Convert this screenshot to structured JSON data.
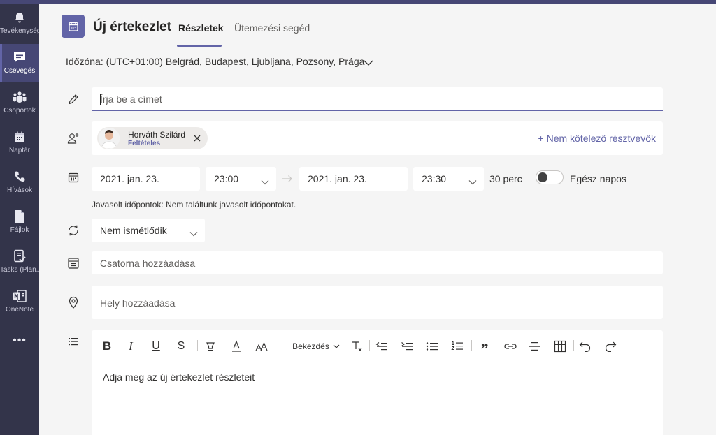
{
  "rail": {
    "items": [
      {
        "label": "Tevékenység",
        "icon": "bell-icon"
      },
      {
        "label": "Csevegés",
        "icon": "chat-icon"
      },
      {
        "label": "Csoportok",
        "icon": "teams-icon"
      },
      {
        "label": "Naptár",
        "icon": "calendar-icon"
      },
      {
        "label": "Hívások",
        "icon": "phone-icon"
      },
      {
        "label": "Fájlok",
        "icon": "file-icon"
      },
      {
        "label": "Tasks (Plan...",
        "icon": "tasks-icon"
      },
      {
        "label": "OneNote",
        "icon": "onenote-icon"
      }
    ],
    "more": "•••",
    "active_index": 1
  },
  "header": {
    "title": "Új értekezlet",
    "tabs": [
      {
        "label": "Részletek"
      },
      {
        "label": "Ütemezési segéd"
      }
    ],
    "active_tab": 0
  },
  "timezone": {
    "label": "Időzóna: (UTC+01:00) Belgrád, Budapest, Ljubljana, Pozsony, Prága"
  },
  "form": {
    "title_placeholder": "Írja be a címet",
    "attendee": {
      "name": "Horváth Szilárd",
      "status": "Feltételes"
    },
    "optional_label": "+ Nem kötelező résztvevők",
    "start_date": "2021. jan. 23.",
    "start_time": "23:00",
    "end_date": "2021. jan. 23.",
    "end_time": "23:30",
    "duration": "30 perc",
    "all_day_label": "Egész napos",
    "all_day": false,
    "suggestions": "Javasolt időpontok: Nem találtunk javasolt időpontokat.",
    "recurrence": "Nem ismétlődik",
    "channel_placeholder": "Csatorna hozzáadása",
    "location_placeholder": "Hely hozzáadása"
  },
  "editor": {
    "paragraph_label": "Bekezdés",
    "placeholder": "Adja meg az új értekezlet részleteit"
  },
  "colors": {
    "accent": "#6264a7",
    "rail": "#33344a",
    "topbar": "#464775"
  }
}
